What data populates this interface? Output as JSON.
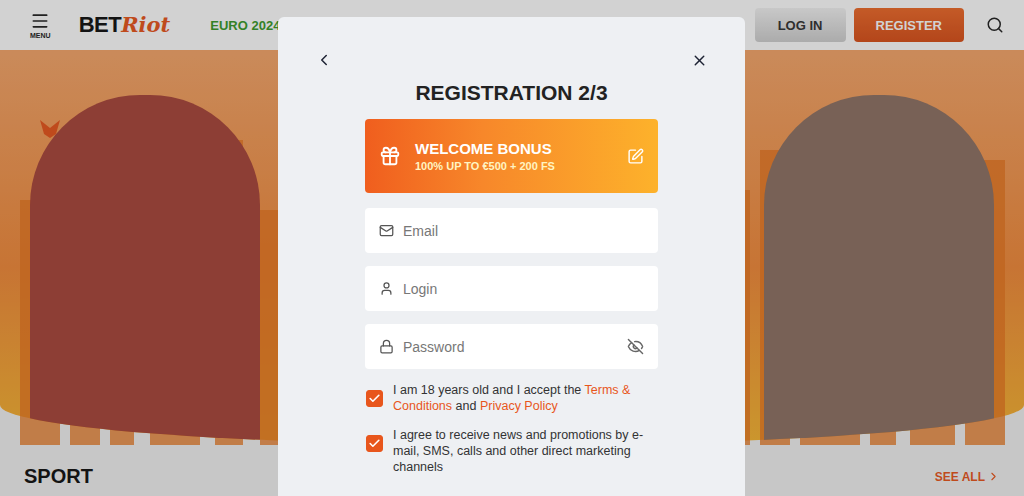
{
  "header": {
    "menu_label": "MENU",
    "logo": {
      "bet": "BET",
      "riot": "Riot"
    },
    "nav": [
      "EURO 2024"
    ],
    "buttons": [
      {
        "label": "LOG IN",
        "kind": "secondary"
      },
      {
        "label": "REGISTER",
        "kind": "primary"
      }
    ]
  },
  "sections": [
    {
      "title": "SPORT",
      "link": "SEE ALL"
    }
  ],
  "modal": {
    "title": "REGISTRATION 2/3",
    "bonus": {
      "title": "WELCOME BONUS",
      "subtitle": "100% UP TO €500 + 200 FS"
    },
    "fields": [
      {
        "placeholder": "Email",
        "kind": "email"
      },
      {
        "placeholder": "Login",
        "kind": "login"
      },
      {
        "placeholder": "Password",
        "kind": "password"
      }
    ],
    "checkboxes": [
      {
        "checked": true,
        "parts": [
          {
            "text": "I am 18 years old and I accept the",
            "link": false
          },
          {
            "text": "Terms & Conditions",
            "link": true
          },
          {
            "text": "and",
            "link": false
          },
          {
            "text": "Privacy Policy",
            "link": true
          }
        ]
      },
      {
        "checked": true,
        "parts": [
          {
            "text": "I agree to receive news and promotions by e-mail, SMS, calls and other direct marketing channels",
            "link": false
          }
        ]
      }
    ]
  }
}
